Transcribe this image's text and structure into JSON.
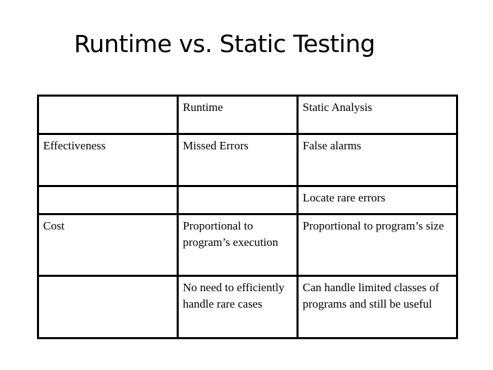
{
  "slide": {
    "title": "Runtime vs. Static Testing"
  },
  "table": {
    "header": {
      "blank": "",
      "runtime": "Runtime",
      "static": "Static Analysis"
    },
    "rows": [
      {
        "label": "Effectiveness",
        "runtime": "Missed  Errors",
        "static": "False alarms"
      },
      {
        "label": "",
        "runtime": "",
        "static": "Locate rare errors"
      },
      {
        "label": "Cost",
        "runtime": "Proportional to program’s execution",
        "static": "Proportional to program’s size"
      },
      {
        "label": "",
        "runtime": "No need to efficiently handle rare cases",
        "static": "Can handle limited classes of programs and still be useful"
      }
    ]
  }
}
